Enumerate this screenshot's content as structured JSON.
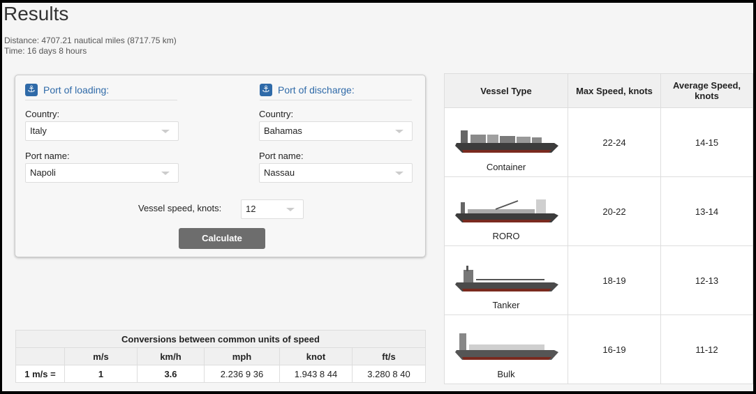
{
  "results": {
    "title": "Results",
    "distance": "Distance: 4707.21 nautical miles (8717.75 km)",
    "time": "Time: 16 days 8 hours"
  },
  "form": {
    "loading_title": "Port of loading:",
    "discharge_title": "Port of discharge:",
    "country_label": "Country:",
    "port_label": "Port name:",
    "loading_country": "Italy",
    "loading_port": "Napoli",
    "discharge_country": "Bahamas",
    "discharge_port": "Nassau",
    "speed_label": "Vessel speed, knots:",
    "speed_value": "12",
    "calculate_label": "Calculate"
  },
  "conversions": {
    "caption": "Conversions between common units of speed",
    "headers": [
      "",
      "m/s",
      "km/h",
      "mph",
      "knot",
      "ft/s"
    ],
    "row": [
      "1 m/s =",
      "1",
      "3.6",
      "2.236 9 36",
      "1.943 8 44",
      "3.280 8 40"
    ]
  },
  "vessels": {
    "headers": [
      "Vessel Type",
      "Max Speed, knots",
      "Average Speed, knots"
    ],
    "rows": [
      {
        "type": "Container",
        "max": "22-24",
        "avg": "14-15"
      },
      {
        "type": "RORO",
        "max": "20-22",
        "avg": "13-14"
      },
      {
        "type": "Tanker",
        "max": "18-19",
        "avg": "12-13"
      },
      {
        "type": "Bulk",
        "max": "16-19",
        "avg": "11-12"
      }
    ]
  },
  "colors": {
    "accent": "#2f6aa8",
    "button": "#6d6d6d",
    "hull": "#3c3c3c",
    "hull_bottom": "#7a2a1f"
  }
}
